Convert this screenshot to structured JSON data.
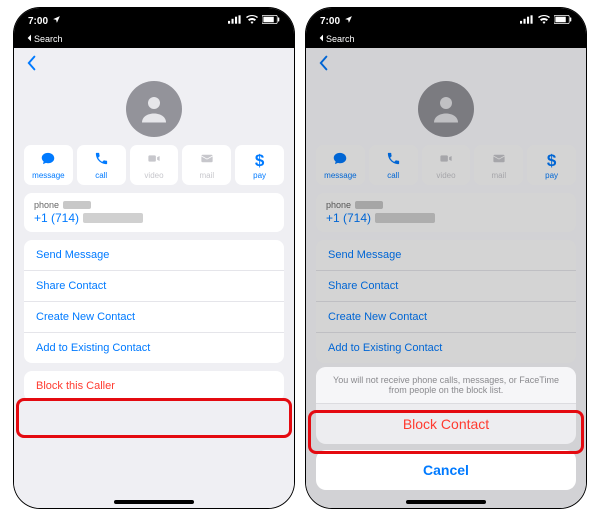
{
  "status": {
    "time": "7:00",
    "back_label": "Search"
  },
  "actions": {
    "message": "message",
    "call": "call",
    "video": "video",
    "mail": "mail",
    "pay": "pay"
  },
  "phone": {
    "label": "phone",
    "number_prefix": "+1 (714)"
  },
  "options": {
    "send_message": "Send Message",
    "share_contact": "Share Contact",
    "create_new": "Create New Contact",
    "add_existing": "Add to Existing Contact",
    "block": "Block this Caller"
  },
  "sheet": {
    "info": "You will not receive phone calls, messages, or FaceTime from people on the block list.",
    "block": "Block Contact",
    "cancel": "Cancel"
  }
}
